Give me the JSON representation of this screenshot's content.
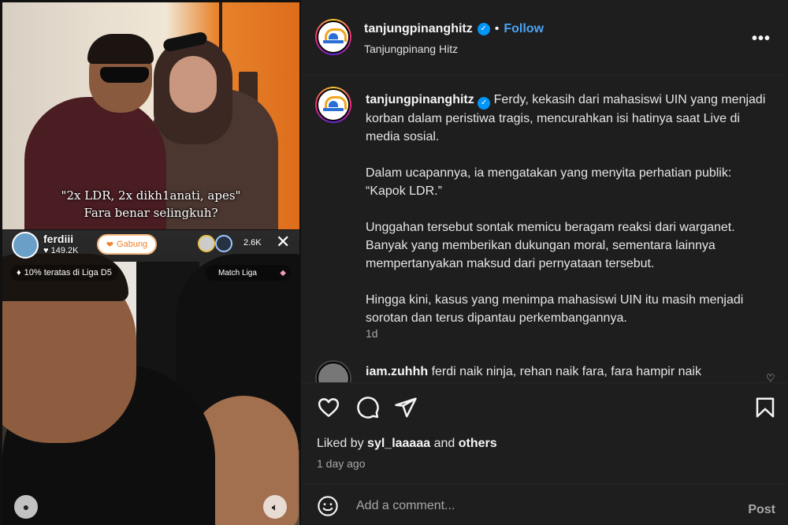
{
  "media": {
    "caption_line1": "\"2x LDR, 2x dikh1anati, apes\"",
    "caption_line2": "Fara benar selingkuh?",
    "live": {
      "streamer": "ferdiii",
      "likes": "149.2K",
      "join_label": "Gabung",
      "viewer_count": "2.6K",
      "league_label": "10% teratas di Liga D5",
      "match_label": "Match Liga"
    }
  },
  "header": {
    "username": "tanjungpinanghitz",
    "follow_label": "Follow",
    "subtitle": "Tanjungpinang Hitz"
  },
  "caption": {
    "username": "tanjungpinanghitz",
    "text": "Ferdy, kekasih dari mahasiswi UIN yang menjadi korban dalam peristiwa tragis, mencurahkan isi hatinya saat Live di media sosial.\n\nDalam ucapannya, ia mengatakan yang menyita perhatian publik: “Kapok LDR.”\n\nUnggahan tersebut sontak memicu beragam reaksi dari warganet. Banyak yang memberikan dukungan moral, sementara lainnya mempertanyakan maksud dari pernyataan tersebut.\n\nHingga kini, kasus yang menimpa mahasiswi UIN itu masih menjadi sorotan dan terus dipantau perkembangannya.",
    "time": "1d"
  },
  "comment": {
    "username": "iam.zuhhh",
    "text": "ferdi naik ninja, rehan naik fara, fara hampir naik"
  },
  "engagement": {
    "liked_by_prefix": "Liked by",
    "liked_by_user": "syl_laaaaa",
    "liked_by_and": "and",
    "liked_by_others": "others",
    "date": "1 day ago"
  },
  "comment_box": {
    "placeholder": "Add a comment...",
    "post_label": "Post"
  },
  "colors": {
    "panel_bg": "#1e1e1e",
    "link": "#4ba3f5",
    "verified": "#0095f6",
    "muted": "#a8a8a8"
  }
}
